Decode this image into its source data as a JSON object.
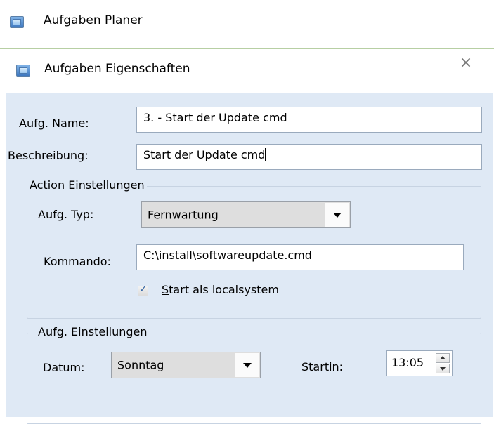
{
  "parent_window": {
    "title": "Aufgaben Planer",
    "icon": "window-app-icon"
  },
  "dialog": {
    "title": "Aufgaben Eigenschaften",
    "close_symbol": "×",
    "icon": "window-app-icon"
  },
  "fields": {
    "name": {
      "label": "Aufg. Name:",
      "value": "3. - Start der Update cmd"
    },
    "description": {
      "label": "Beschreibung:",
      "value": "Start der Update cmd"
    }
  },
  "action_group": {
    "caption": "Action Einstellungen",
    "type": {
      "label": "Aufg. Typ:",
      "selected": "Fernwartung"
    },
    "command": {
      "label": "Kommando:",
      "value": "C:\\install\\softwareupdate.cmd"
    },
    "localsystem": {
      "label": "Start als localsystem",
      "checked": true
    }
  },
  "schedule_group": {
    "caption": "Aufg. Einstellungen",
    "date": {
      "label": "Datum:",
      "selected": "Sonntag"
    },
    "start": {
      "label": "Startin:",
      "value": "13:05"
    }
  }
}
